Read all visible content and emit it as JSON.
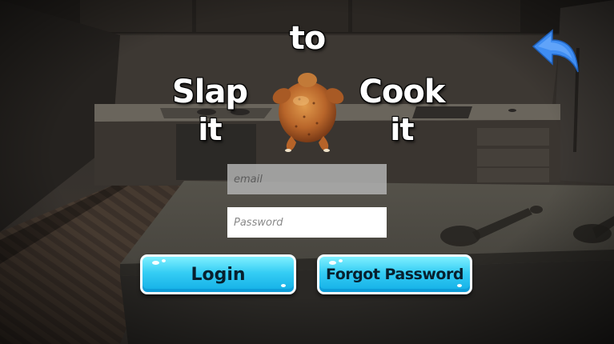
{
  "title": {
    "slap": "Slap",
    "slap_it": "it",
    "to": "to",
    "cook": "Cook",
    "cook_it": "it"
  },
  "form": {
    "email_placeholder": "email",
    "password_placeholder": "Password"
  },
  "buttons": {
    "login": "Login",
    "forgot_password": "Forgot Password"
  },
  "icons": {
    "back": "back-arrow-icon",
    "chicken": "roast-chicken-icon"
  },
  "colors": {
    "button_gradient_top": "#7ff0ff",
    "button_gradient_bottom": "#12aee6",
    "back_arrow": "#3f8df2"
  }
}
